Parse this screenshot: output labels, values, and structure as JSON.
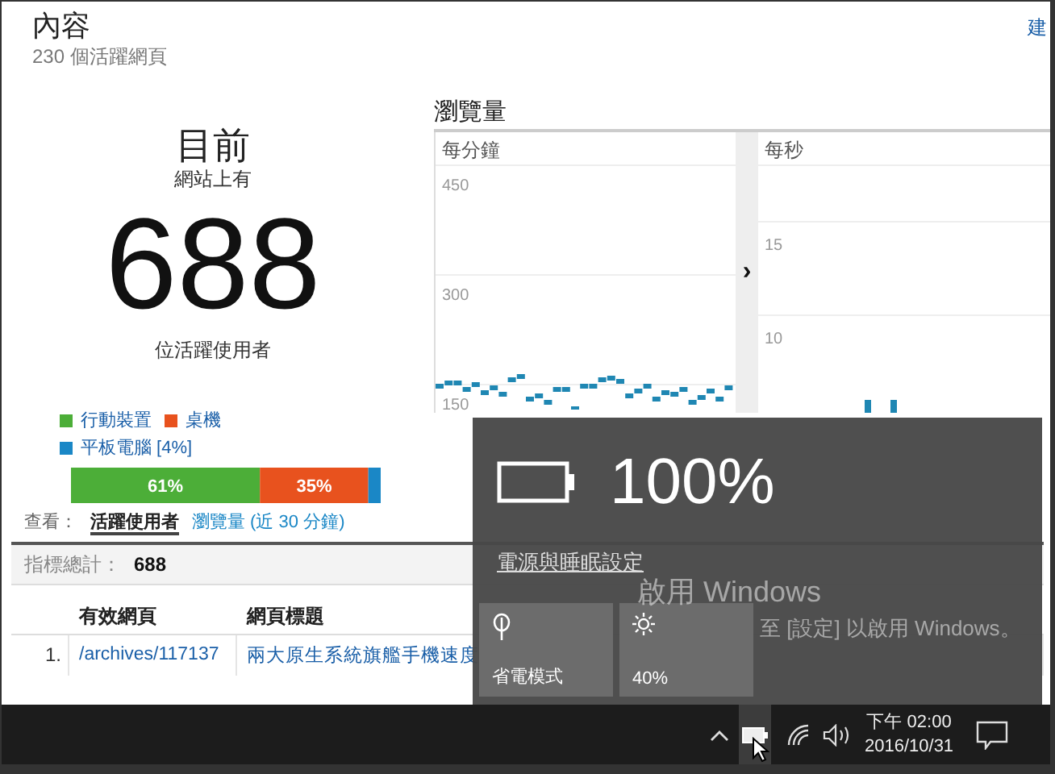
{
  "header": {
    "title": "內容",
    "subtitle": "230 個活躍網頁",
    "corner_link": "建"
  },
  "summary": {
    "heading": "目前",
    "prefix": "網站上有",
    "count": "688",
    "suffix": "位活躍使用者"
  },
  "devices": {
    "chart_data": {
      "type": "bar",
      "orientation": "horizontal",
      "stacked": true,
      "categories": [
        null
      ],
      "series": [
        {
          "name": "行動裝置",
          "color": "#4cae38",
          "values": [
            61
          ],
          "value_labels": [
            "61%"
          ]
        },
        {
          "name": "桌機",
          "color": "#e8521e",
          "values": [
            35
          ],
          "value_labels": [
            "35%"
          ]
        },
        {
          "name": "平板電腦 [4%]",
          "color": "#1a87c6",
          "values": [
            4
          ],
          "value_labels": [
            null
          ]
        }
      ]
    }
  },
  "view_tabs": {
    "label": "查看：",
    "tabs": [
      {
        "label": "活躍使用者",
        "selected": true
      },
      {
        "label": "瀏覽量 (近 30 分鐘)",
        "selected": false
      }
    ]
  },
  "table": {
    "total_label": "指標總計：",
    "total_value": "688",
    "columns": [
      "有效網頁",
      "網頁標題"
    ],
    "rows": [
      {
        "index": "1.",
        "page": "/archives/117137",
        "title": "兩大原生系統旗艦手機速度"
      }
    ]
  },
  "pageviews": {
    "title": "瀏覽量",
    "per_minute": {
      "label": "每分鐘",
      "ticks": [
        "450",
        "300",
        "150"
      ]
    },
    "expand": "›",
    "per_second": {
      "label": "每秒",
      "ticks": [
        "15",
        "10"
      ]
    }
  },
  "flyout": {
    "battery": "100%",
    "settings_link": "電源與睡眠設定",
    "tiles": [
      {
        "kind": "saver",
        "label": "省電模式",
        "on": false
      },
      {
        "kind": "brightness",
        "label": "40%"
      }
    ]
  },
  "activation": {
    "title": "啟用 Windows",
    "message": "至 [設定] 以啟用 Windows。"
  },
  "taskbar": {
    "time": "下午 02:00",
    "date": "2016/10/31"
  }
}
